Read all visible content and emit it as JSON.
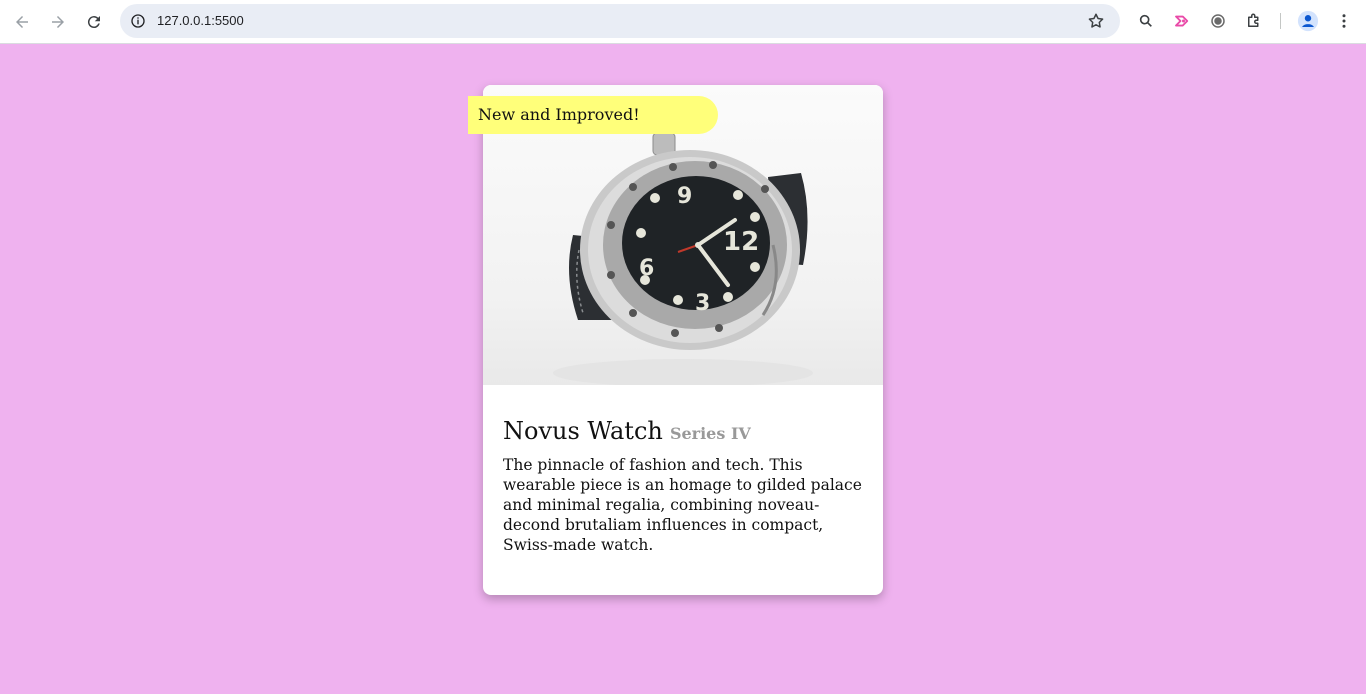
{
  "browser": {
    "url": "127.0.0.1:5500",
    "nav": {
      "back_icon": "arrow-left-icon",
      "forward_icon": "arrow-right-icon",
      "reload_icon": "reload-icon"
    },
    "toolbar_icons": [
      "site-info-icon",
      "bookmark-star-icon",
      "search-icon",
      "extension-arrow-icon",
      "copyright-extension-icon",
      "extensions-puzzle-icon",
      "profile-avatar-icon",
      "more-menu-icon"
    ]
  },
  "page": {
    "background_color": "#efb2ef",
    "card": {
      "badge": "New and Improved!",
      "badge_color": "#ffff7a",
      "image_alt": "watch-image",
      "title": "Novus Watch",
      "series": "Series IV",
      "description": "The pinnacle of fashion and tech. This wearable piece is an homage to gilded palace and minimal regalia, combining noveau-decond brutaliam influences in compact, Swiss-made watch."
    }
  }
}
